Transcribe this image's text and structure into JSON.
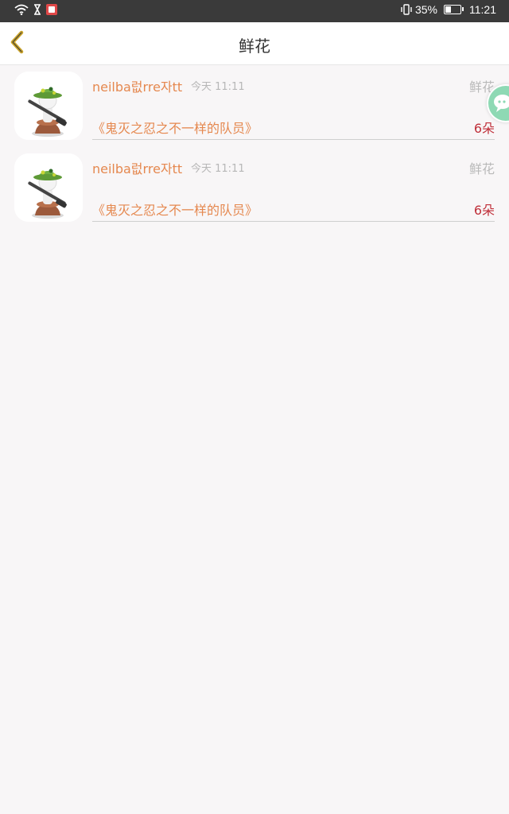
{
  "status_bar": {
    "battery": "35%",
    "time": "11:21",
    "icons": [
      "wifi-icon",
      "hourglass-icon",
      "app-notification-icon",
      "vibrate-icon",
      "battery-icon"
    ],
    "battery_level": 0.35
  },
  "header": {
    "title": "鲜花",
    "back_icon": "chevron-left-icon"
  },
  "items": [
    {
      "username": "neilba럾rre자tt",
      "time": "今天 11:11",
      "type": "鲜花",
      "book": "《鬼灭之忍之不一样的队员》",
      "count": "6朵"
    },
    {
      "username": "neilba럾rre자tt",
      "time": "今天 11:11",
      "type": "鲜花",
      "book": "《鬼灭之忍之不一样的队员》",
      "count": "6朵"
    }
  ],
  "floating_button": {
    "icon": "chat-bubble-icon",
    "color": "#8ed9b4"
  },
  "colors": {
    "accent": "#e5884f",
    "count": "#c0303a",
    "muted": "#b9b9b9",
    "back_icon": "#c9a227"
  }
}
